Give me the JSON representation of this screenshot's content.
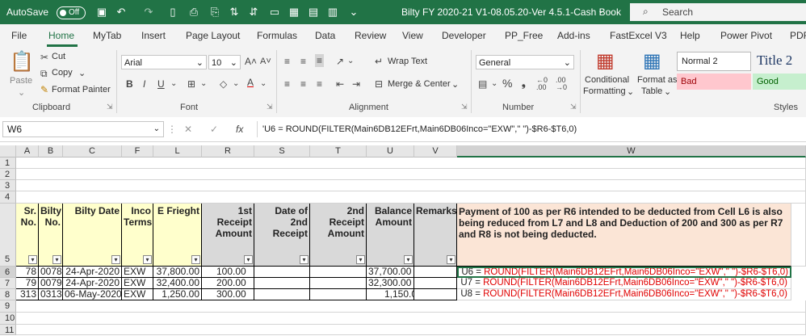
{
  "titlebar": {
    "autosave_label": "AutoSave",
    "autosave_state": "Off",
    "doc_title": "Bilty FY 2020-21 V1-08.05.20-Ver 4.5.1-Cash Book",
    "search_placeholder": "Search"
  },
  "tabs": [
    "File",
    "Home",
    "MyTab",
    "Insert",
    "Page Layout",
    "Formulas",
    "Data",
    "Review",
    "View",
    "Developer",
    "PP_Free",
    "Add-ins",
    "FastExcel V3",
    "Help",
    "Power Pivot",
    "PDF"
  ],
  "active_tab": "Home",
  "ribbon": {
    "clipboard": {
      "paste": "Paste",
      "cut": "Cut",
      "copy": "Copy",
      "format_painter": "Format Painter",
      "label": "Clipboard"
    },
    "font": {
      "name": "Arial",
      "size": "10",
      "label": "Font"
    },
    "alignment": {
      "wrap": "Wrap Text",
      "merge": "Merge & Center",
      "label": "Alignment"
    },
    "number": {
      "format": "General",
      "label": "Number"
    },
    "cond_format": {
      "line1": "Conditional",
      "line2": "Formatting"
    },
    "format_table": {
      "line1": "Format as",
      "line2": "Table"
    },
    "styles": {
      "normal2": "Normal 2",
      "title2": "Title 2",
      "bad": "Bad",
      "good": "Good",
      "label": "Styles"
    }
  },
  "formula_bar": {
    "name_box": "W6",
    "formula": "'U6 = ROUND(FILTER(Main6DB12EFrt,Main6DB06Inco=\"EXW\",\" \")-$R6-$T6,0)"
  },
  "grid": {
    "columns": [
      "A",
      "B",
      "C",
      "F",
      "L",
      "R",
      "S",
      "T",
      "U",
      "V",
      "W"
    ],
    "row_numbers": [
      "1",
      "2",
      "3",
      "4",
      "5",
      "6",
      "7",
      "8",
      "9",
      "10",
      "11"
    ],
    "headers": {
      "sr": "Sr. No.",
      "bilty_no": "Bilty No.",
      "bilty_date": "Bilty Date",
      "inco": "Inco Terms",
      "freight": "E Frieght",
      "receipt1": "1st Receipt Amount",
      "date2": "Date of 2nd Receipt",
      "receipt2": "2nd Receipt Amount",
      "balance": "Balance Amount",
      "remarks": "Remarks",
      "note": "Payment of 100 as per R6 intended to be deducted from Cell L6 is also being reduced from  L7 and L8 and Deduction of 200 and 300 as per R7 and R8 is not being deducted."
    },
    "rows": [
      {
        "sr": "78",
        "bilty": "0078",
        "date": "24-Apr-2020",
        "inco": "EXW",
        "freight": "37,800.00",
        "r1": "100.00",
        "bal": "37,700.00",
        "ref": "U6 = ",
        "fml": "ROUND(FILTER(Main6DB12EFrt,Main6DB06Inco=\"EXW\",\" \")-$R6-$T6,0)"
      },
      {
        "sr": "79",
        "bilty": "0079",
        "date": "24-Apr-2020",
        "inco": "EXW",
        "freight": "32,400.00",
        "r1": "200.00",
        "bal": "32,300.00",
        "ref": "U7 = ",
        "fml": "ROUND(FILTER(Main6DB12EFrt,Main6DB06Inco=\"EXW\",\" \")-$R6-$T6,0)"
      },
      {
        "sr": "313",
        "bilty": "0313",
        "date": "06-May-2020",
        "inco": "EXW",
        "freight": "1,250.00",
        "r1": "300.00",
        "bal": "1,150.00",
        "ref": "U8 = ",
        "fml": "ROUND(FILTER(Main6DB12EFrt,Main6DB06Inco=\"EXW\",\" \")-$R6-$T6,0)"
      }
    ]
  },
  "colors": {
    "excel_green": "#217346",
    "header_fill": "#ffffcc",
    "gray_fill": "#d9d9d9",
    "note_fill": "#fbe5d6",
    "formula_red": "#e00000"
  }
}
